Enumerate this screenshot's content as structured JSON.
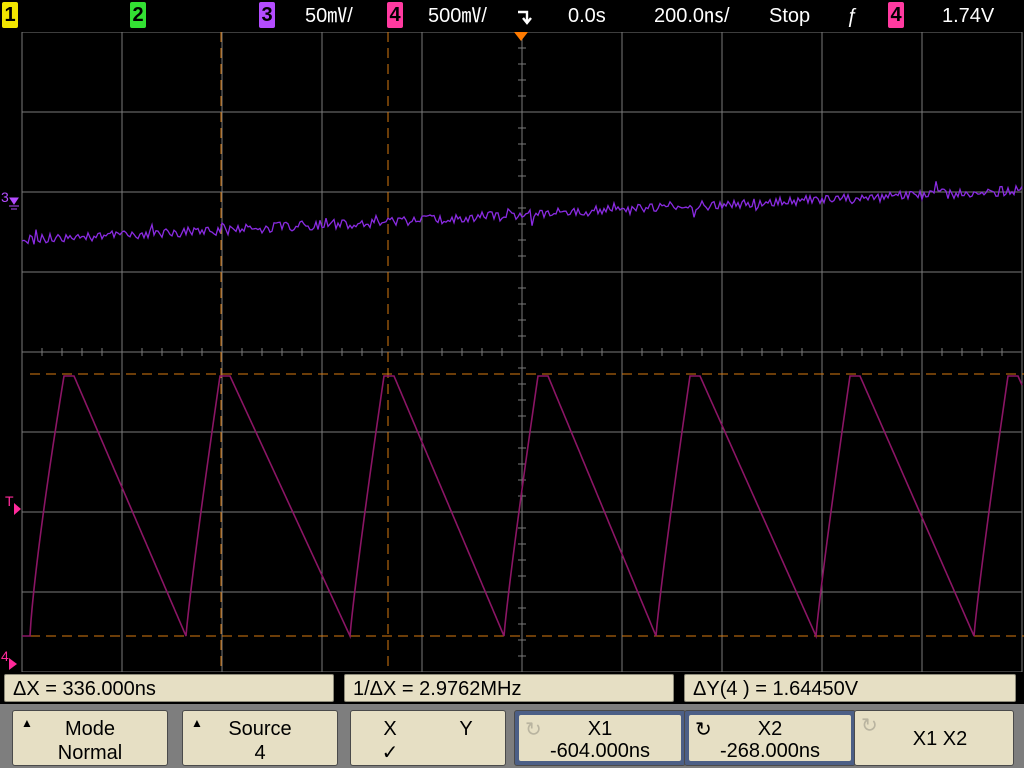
{
  "topbar": {
    "channels": [
      {
        "num": "1",
        "color": "#f2e600"
      },
      {
        "num": "2",
        "color": "#33e033"
      },
      {
        "num": "3",
        "color": "#b44cff"
      },
      {
        "num": "4",
        "color": "#ff3aa0"
      }
    ],
    "ch3_scale": "50㎷/",
    "ch4_scale": "500㎷/",
    "delay": "0.0s",
    "timebase": "200.0㎱/",
    "run_state": "Stop",
    "trigger_slope": "ƒ",
    "trigger_channel": "4",
    "trigger_level": "1.74V"
  },
  "markers": {
    "ch3": "3",
    "trigger": "T",
    "ch4": "4"
  },
  "measurements": {
    "delta_x": "ΔX = 336.000ns",
    "inv_delta_x": "1/ΔX = 2.9762MHz",
    "delta_y": "ΔY(4 ) = 1.64450V"
  },
  "softkeys": {
    "mode": {
      "title": "Mode",
      "value": "Normal"
    },
    "source": {
      "title": "Source",
      "value": "4"
    },
    "xy": {
      "x": "X",
      "y": "Y",
      "check": "✓"
    },
    "x1": {
      "title": "X1",
      "value": "-604.000ns"
    },
    "x2": {
      "title": "X2",
      "value": "-268.000ns"
    },
    "x1x2": {
      "label": "X1 X2"
    }
  },
  "colors": {
    "grid": "#7a7a7a",
    "ch3_trace": "#8a2be2",
    "ch4_trace": "#8b1565",
    "cursor": "#d97a10",
    "trigger_marker": "#ff7a00",
    "ch4_marker": "#ff2a9a"
  },
  "icons": [
    "trigger-delay-icon",
    "cycle-arrow-icon",
    "up-arrow-icon"
  ]
}
